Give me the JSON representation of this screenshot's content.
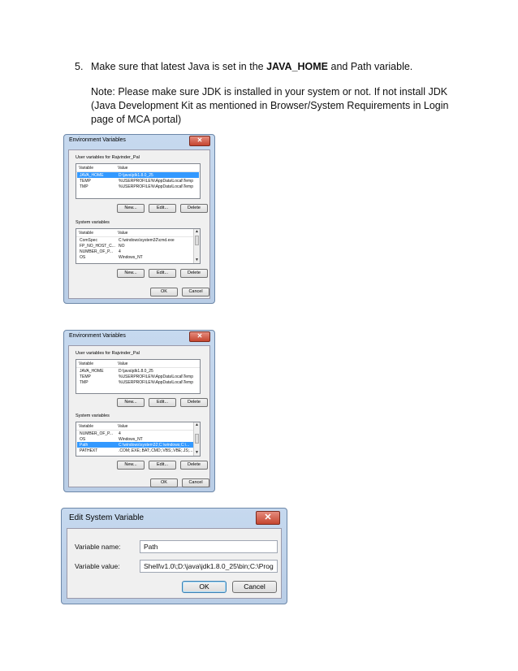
{
  "instructions": {
    "number": "5.",
    "line1_before": "Make sure that latest Java is set in the ",
    "line1_bold": "JAVA_HOME",
    "line1_after": " and Path variable.",
    "note": "Note: Please make sure JDK is installed in your system or not. If not install JDK (Java Development Kit as mentioned in Browser/System Requirements in Login page of MCA portal)"
  },
  "env_dialog_1": {
    "title": "Environment Variables",
    "user_label": "User variables for Rajvinder_Pal",
    "col_variable": "Variable",
    "col_value": "Value",
    "user_rows": [
      {
        "variable": "JAVA_HOME",
        "value": "D:\\java\\jdk1.8.0_25"
      },
      {
        "variable": "TEMP",
        "value": "%USERPROFILE%\\AppData\\Local\\Temp"
      },
      {
        "variable": "TMP",
        "value": "%USERPROFILE%\\AppData\\Local\\Temp"
      }
    ],
    "system_label": "System variables",
    "system_rows": [
      {
        "variable": "ComSpec",
        "value": "C:\\windows\\system32\\cmd.exe"
      },
      {
        "variable": "FP_NO_HOST_C...",
        "value": "NO"
      },
      {
        "variable": "NUMBER_OF_P...",
        "value": "4"
      },
      {
        "variable": "OS",
        "value": "Windows_NT"
      }
    ],
    "new_label": "New...",
    "edit_label": "Edit...",
    "delete_label": "Delete",
    "ok_label": "OK",
    "cancel_label": "Cancel"
  },
  "env_dialog_2": {
    "title": "Environment Variables",
    "user_label": "User variables for Rajvinder_Pal",
    "col_variable": "Variable",
    "col_value": "Value",
    "user_rows": [
      {
        "variable": "JAVA_HOME",
        "value": "D:\\java\\jdk1.8.0_25"
      },
      {
        "variable": "TEMP",
        "value": "%USERPROFILE%\\AppData\\Local\\Temp"
      },
      {
        "variable": "TMP",
        "value": "%USERPROFILE%\\AppData\\Local\\Temp"
      }
    ],
    "system_label": "System variables",
    "system_rows": [
      {
        "variable": "NUMBER_OF_P...",
        "value": "4"
      },
      {
        "variable": "OS",
        "value": "Windows_NT"
      },
      {
        "variable": "Path",
        "value": "C:\\windows\\system32;C:\\windows;C:\\..."
      },
      {
        "variable": "PATHEXT",
        "value": ".COM;.EXE;.BAT;.CMD;.VBS;.VBE;.JS;..."
      }
    ],
    "new_label": "New...",
    "edit_label": "Edit...",
    "delete_label": "Delete",
    "ok_label": "OK",
    "cancel_label": "Cancel"
  },
  "edit_dialog": {
    "title": "Edit System Variable",
    "name_label": "Variable name:",
    "name_value": "Path",
    "value_label": "Variable value:",
    "value_value": "Shell\\v1.0\\;D:\\java\\jdk1.8.0_25\\bin;C:\\Prog",
    "ok_label": "OK",
    "cancel_label": "Cancel"
  }
}
